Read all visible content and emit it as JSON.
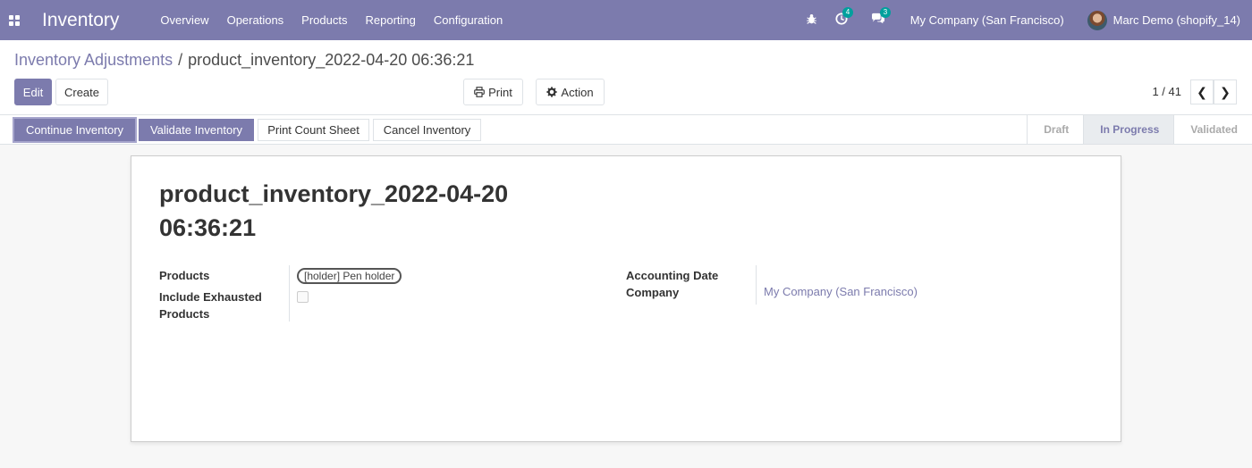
{
  "navbar": {
    "brand": "Inventory",
    "menu": [
      "Overview",
      "Operations",
      "Products",
      "Reporting",
      "Configuration"
    ],
    "activities_count": "4",
    "messages_count": "3",
    "company": "My Company (San Francisco)",
    "user": "Marc Demo (shopify_14)"
  },
  "breadcrumb": {
    "parent": "Inventory Adjustments",
    "separator": "/",
    "current": "product_inventory_2022-04-20 06:36:21"
  },
  "toolbar": {
    "edit": "Edit",
    "create": "Create",
    "print": "Print",
    "action": "Action"
  },
  "pager": {
    "text": "1 / 41"
  },
  "statusbar": {
    "buttons": [
      "Continue Inventory",
      "Validate Inventory",
      "Print Count Sheet",
      "Cancel Inventory"
    ],
    "stages": [
      "Draft",
      "In Progress",
      "Validated"
    ],
    "current_stage": "In Progress"
  },
  "form": {
    "title": "product_inventory_2022-04-20 06:36:21",
    "products_label": "Products",
    "products_tag": "[holder] Pen holder",
    "exhausted_label": "Include Exhausted Products",
    "exhausted_checked": false,
    "accounting_date_label": "Accounting Date",
    "company_label": "Company",
    "company_value": "My Company (San Francisco)"
  },
  "colors": {
    "brand": "#7c7bad",
    "badge": "#00a09d"
  }
}
